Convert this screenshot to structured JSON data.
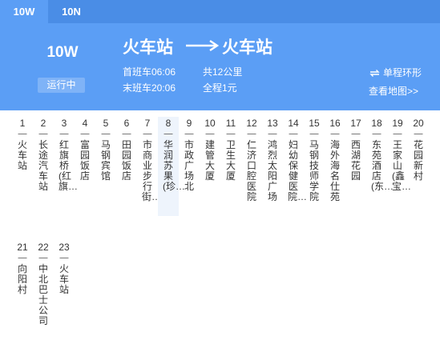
{
  "tabs": [
    "10W",
    "10N"
  ],
  "route": {
    "name": "10W",
    "status": "运行中",
    "from": "火车站",
    "to": "火车站",
    "first_bus": "首班车06:06",
    "last_bus": "末班车20:06",
    "distance": "共12公里",
    "fare": "全程1元",
    "loop_label": "单程环形",
    "map_link": "查看地图>>"
  },
  "stop_dash": "一",
  "stops": [
    {
      "num": "1",
      "name": "火车站"
    },
    {
      "num": "2",
      "name": "长途汽车站"
    },
    {
      "num": "3",
      "name": "红旗桥(红旗…"
    },
    {
      "num": "4",
      "name": "富园饭店"
    },
    {
      "num": "5",
      "name": "马钢宾馆"
    },
    {
      "num": "6",
      "name": "田园饭店"
    },
    {
      "num": "7",
      "name": "市商业步行街…"
    },
    {
      "num": "8",
      "name": "华润苏果(珍…"
    },
    {
      "num": "9",
      "name": "市政广场北"
    },
    {
      "num": "10",
      "name": "建管大厦"
    },
    {
      "num": "11",
      "name": "卫生大厦"
    },
    {
      "num": "12",
      "name": "仁济口腔医院"
    },
    {
      "num": "13",
      "name": "鸿烈太阳广场"
    },
    {
      "num": "14",
      "name": "妇幼保健医院…"
    },
    {
      "num": "15",
      "name": "马钢技师学院"
    },
    {
      "num": "16",
      "name": "海外海名仕苑"
    },
    {
      "num": "17",
      "name": "西湖花园"
    },
    {
      "num": "18",
      "name": "东苑酒店(东…"
    },
    {
      "num": "19",
      "name": "王家山(鑫宝…"
    },
    {
      "num": "20",
      "name": "花园新村"
    },
    {
      "num": "21",
      "name": "向阳村"
    },
    {
      "num": "22",
      "name": "中北巴士公司"
    },
    {
      "num": "23",
      "name": "火车站"
    }
  ]
}
